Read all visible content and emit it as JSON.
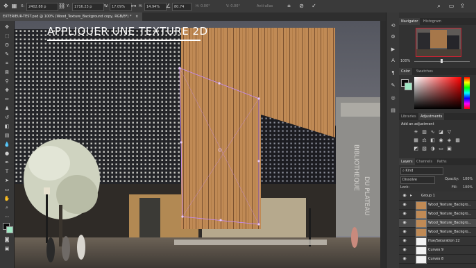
{
  "options_bar": {
    "x_label": "X:",
    "x_value": "2402.88 p",
    "y_label": "Y:",
    "y_value": "1716.23 p",
    "w_label": "W:",
    "w_value": "17.09%",
    "h_label": "H:",
    "h_value": "14.94%",
    "angle_value": "80.74",
    "anti_alias_label": "Anti-alias"
  },
  "document": {
    "tab_title": "EXTERIEUR-TEST.psd @ 100% (Wood_Texture_Background copy, RGB/8*) *",
    "close_glyph": "×"
  },
  "overlay": {
    "title": "APPLIQUER UNE TEXTURE 2D"
  },
  "scene": {
    "building_sign": "BIBLIOTHEQUE",
    "building_sign2": "DU PLATEAU"
  },
  "navigator": {
    "tabs": [
      "Navigator",
      "Histogram"
    ],
    "zoom": "100%"
  },
  "color_panel": {
    "tabs": [
      "Color",
      "Swatches"
    ],
    "foreground": "#0a0a0a",
    "background": "#9fe8c4",
    "picker_hue": "#ff0000"
  },
  "adjustments": {
    "tabs": [
      "Libraries",
      "Adjustments"
    ],
    "hint": "Add an adjustment"
  },
  "layers": {
    "tabs": [
      "Layers",
      "Channels",
      "Paths"
    ],
    "blend_mode": "Dissolve",
    "opacity_label": "Opacity:",
    "opacity_value": "100%",
    "fill_label": "Fill:",
    "fill_value": "100%",
    "lock_label": "Lock:",
    "items": [
      {
        "name": "Group 1",
        "type": "group",
        "selected": false
      },
      {
        "name": "Wood_Texture_Backgro...",
        "type": "layer",
        "selected": false
      },
      {
        "name": "Wood_Texture_Backgro...",
        "type": "layer",
        "selected": false
      },
      {
        "name": "Wood_Texture_Backgro...",
        "type": "layer",
        "selected": true
      },
      {
        "name": "Wood_Texture_Backgro...",
        "type": "layer",
        "selected": false
      },
      {
        "name": "Hue/Saturation 22",
        "type": "adjustment",
        "selected": false
      },
      {
        "name": "Curves 9",
        "type": "adjustment",
        "selected": false
      },
      {
        "name": "Curves 8",
        "type": "adjustment",
        "selected": false
      }
    ]
  }
}
